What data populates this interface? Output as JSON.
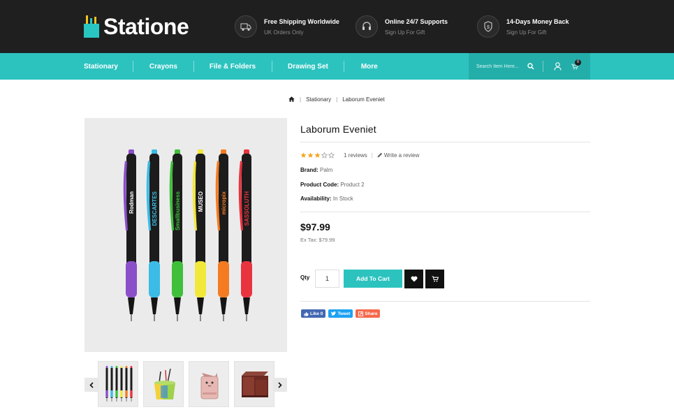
{
  "brand": {
    "name": "Statione"
  },
  "header_features": [
    {
      "icon": "truck-icon",
      "title": "Free Shipping Worldwide",
      "subtitle": "UK Orders Only"
    },
    {
      "icon": "headset-icon",
      "title": "Online 24/7 Supports",
      "subtitle": "Sign Up For Gift"
    },
    {
      "icon": "money-back-icon",
      "title": "14-Days Money Back",
      "subtitle": "Sign Up For Gift"
    }
  ],
  "nav": {
    "items": [
      {
        "label": "Stationary"
      },
      {
        "label": "Crayons"
      },
      {
        "label": "File & Folders"
      },
      {
        "label": "Drawing Set"
      },
      {
        "label": "More"
      }
    ],
    "search_placeholder": "Search Item Here...",
    "cart_count": "0"
  },
  "breadcrumb": {
    "items": [
      {
        "label": "Stationary"
      },
      {
        "label": "Laborum Eveniet"
      }
    ]
  },
  "product": {
    "title": "Laborum Eveniet",
    "rating": 3,
    "rating_max": 5,
    "reviews_label": "1 reviews",
    "write_review_label": "Write a review",
    "brand_label": "Brand:",
    "brand_value": "Palm",
    "code_label": "Product Code:",
    "code_value": "Product 2",
    "availability_label": "Availability:",
    "availability_value": "In Stock",
    "price": "$97.99",
    "ex_tax": "Ex Tax: $79.99",
    "qty_label": "Qty",
    "qty_value": "1",
    "add_to_cart_label": "Add To Cart",
    "pens": [
      {
        "text": "Rodman",
        "color": "#8b4fc9"
      },
      {
        "text": "DESCARTES",
        "color": "#3bbce6"
      },
      {
        "text": "Smallbusiness",
        "color": "#3fbf3a"
      },
      {
        "text": "MUSEO",
        "color": "#f1e83a"
      },
      {
        "text": "micropix",
        "color": "#f57b22"
      },
      {
        "text": "SASSOLUTH",
        "color": "#e8343f"
      }
    ]
  },
  "thumbnails": [
    {
      "name": "thumb-pens"
    },
    {
      "name": "thumb-pen-holder"
    },
    {
      "name": "thumb-cat-pouch"
    },
    {
      "name": "thumb-wooden-organizer"
    }
  ],
  "social": {
    "like_label": "Like 0",
    "tweet_label": "Tweet",
    "share_label": "Share"
  },
  "colors": {
    "accent": "#2cc3bf",
    "header_bg": "#1f1f1f",
    "star_on": "#f4a51c",
    "facebook": "#4267b2",
    "twitter": "#1da1f2",
    "share": "#f5694b"
  }
}
